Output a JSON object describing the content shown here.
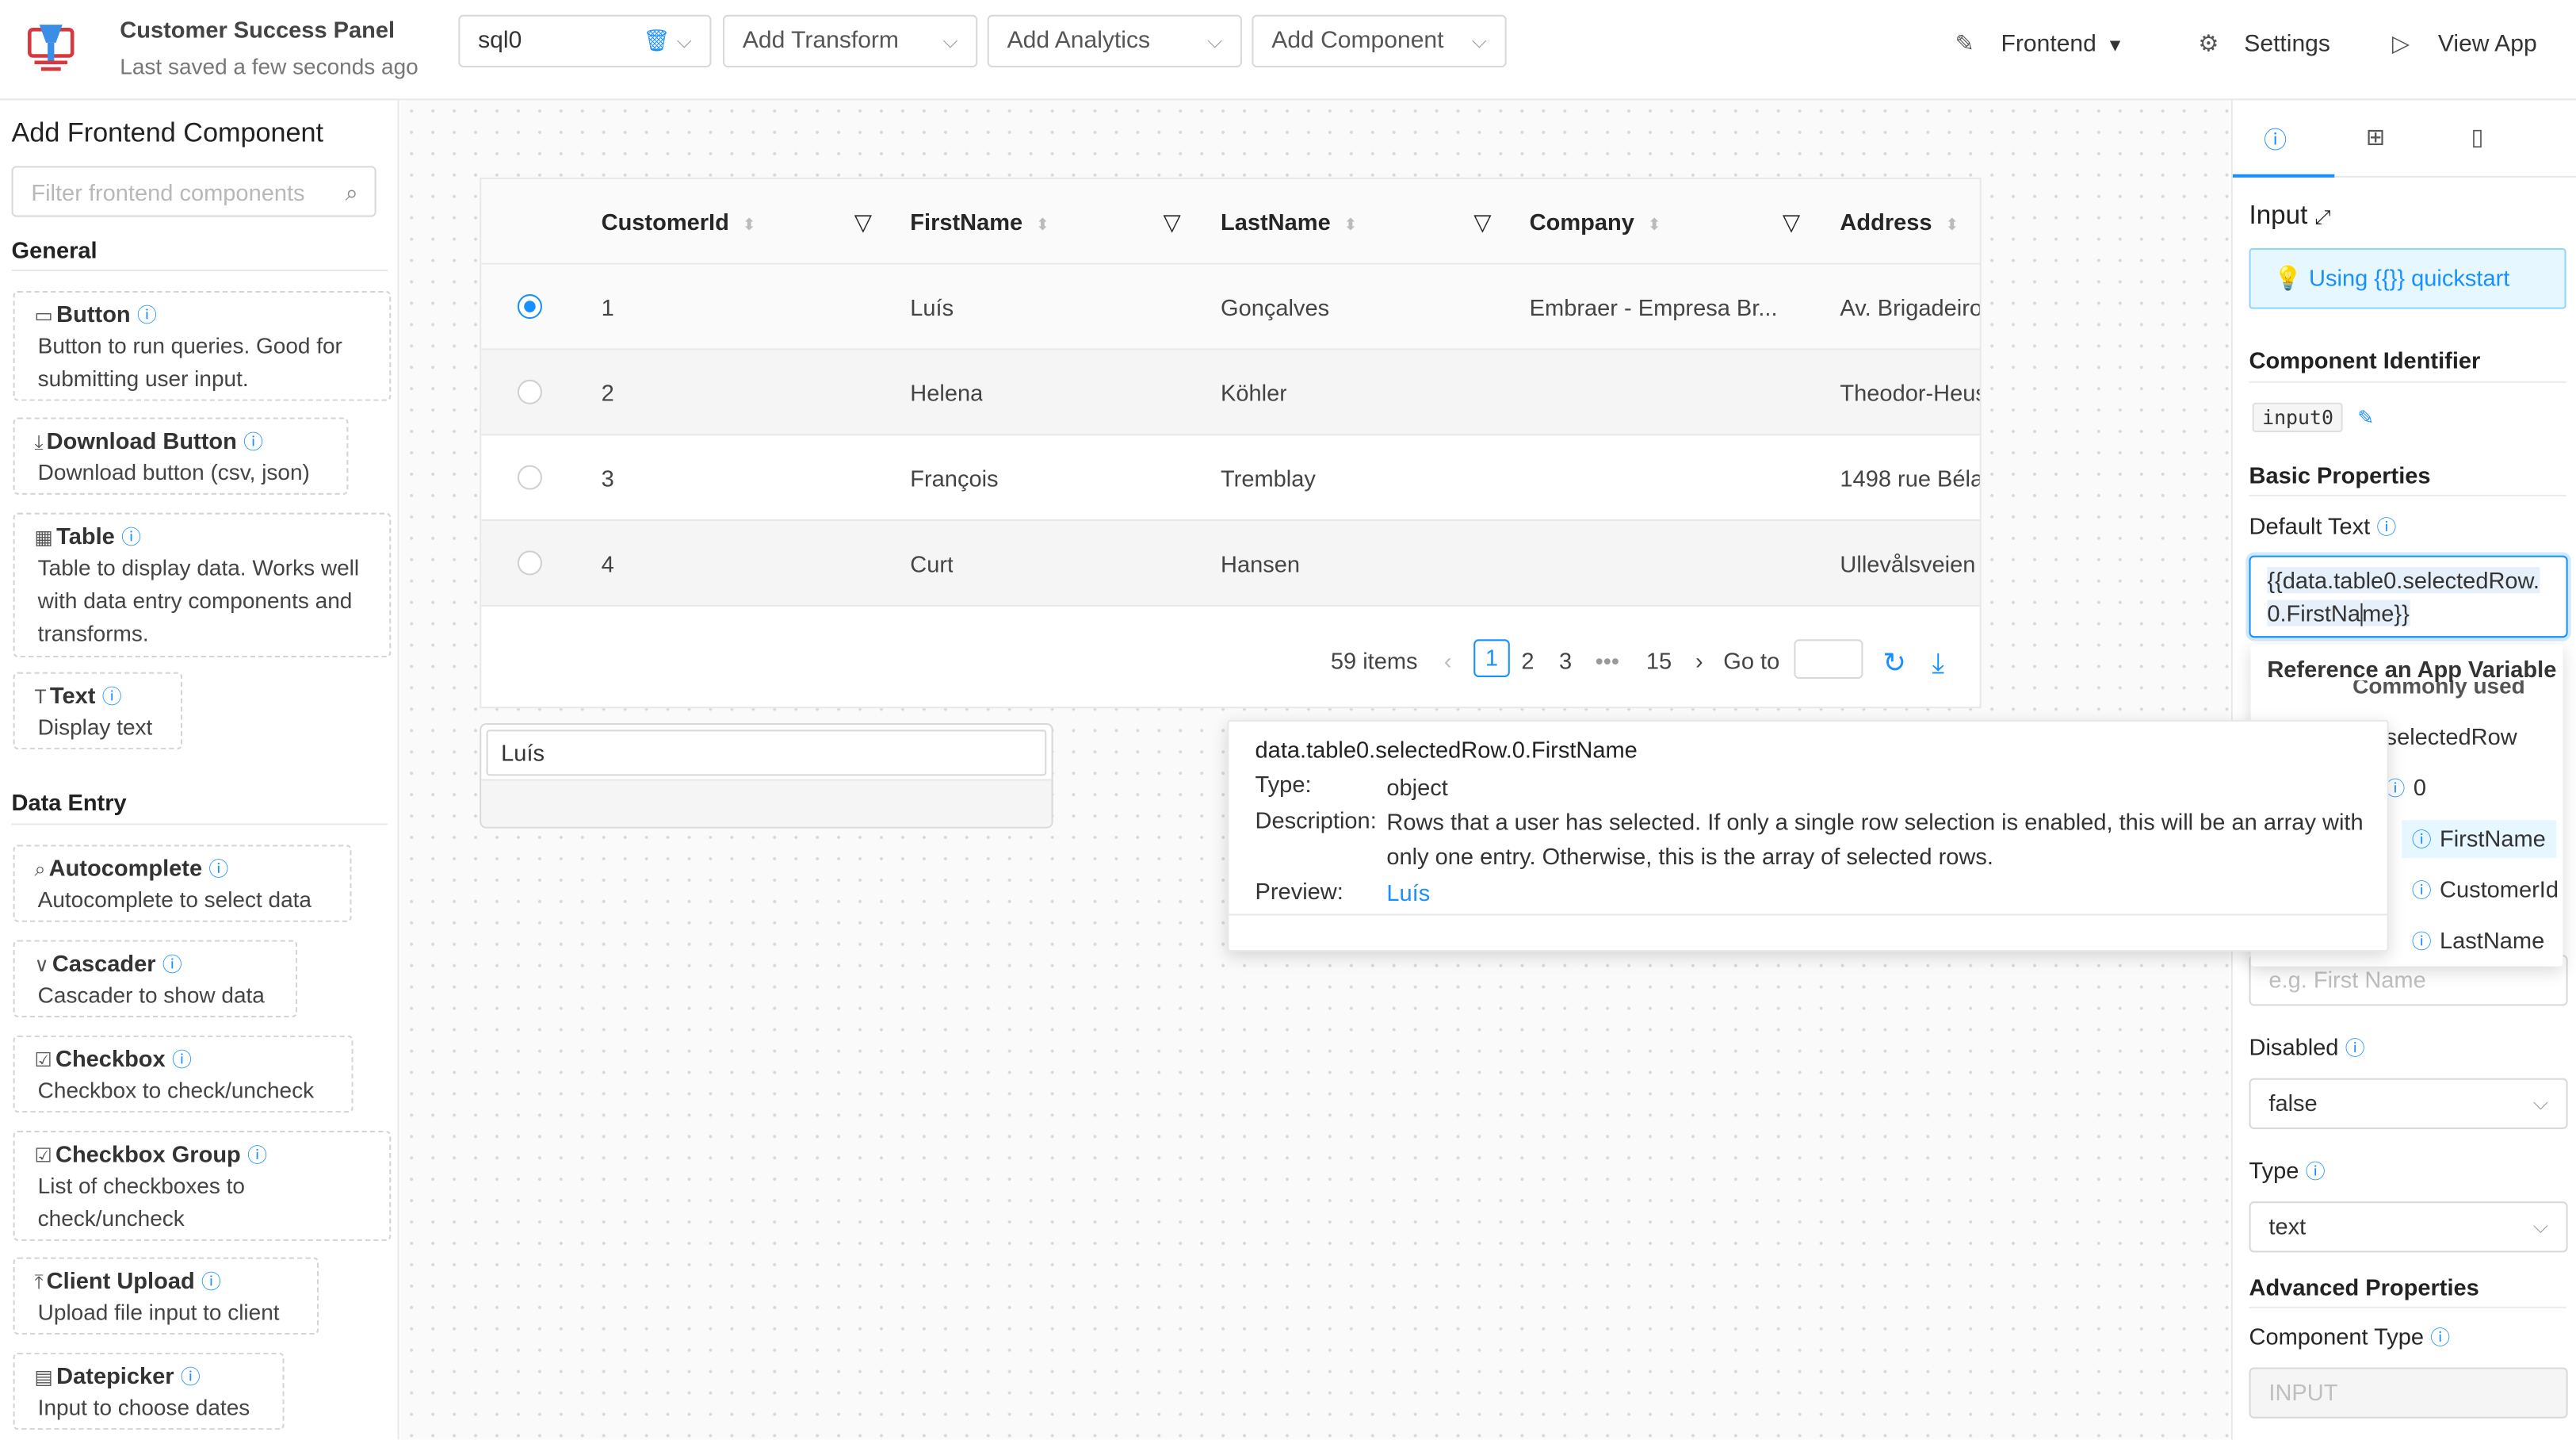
{
  "header": {
    "app_title": "Customer Success Panel",
    "saved_status": "Last saved a few seconds ago",
    "query_select": "sql0",
    "add_transform": "Add Transform",
    "add_analytics": "Add Analytics",
    "add_component": "Add Component",
    "frontend_menu": "Frontend",
    "settings": "Settings",
    "view_app": "View App"
  },
  "left": {
    "title": "Add Frontend Component",
    "filter_placeholder": "Filter frontend components",
    "cat_general": "General",
    "cat_data_entry": "Data Entry",
    "components": [
      {
        "name": "Button",
        "desc": "Button to run queries. Good for submitting user input."
      },
      {
        "name": "Download Button",
        "desc": "Download button (csv, json)"
      },
      {
        "name": "Table",
        "desc": "Table to display data. Works well with data entry components and transforms."
      },
      {
        "name": "Text",
        "desc": "Display text"
      },
      {
        "name": "Autocomplete",
        "desc": "Autocomplete to select data"
      },
      {
        "name": "Cascader",
        "desc": "Cascader to show data"
      },
      {
        "name": "Checkbox",
        "desc": "Checkbox to check/uncheck"
      },
      {
        "name": "Checkbox Group",
        "desc": "List of checkboxes to check/uncheck"
      },
      {
        "name": "Client Upload",
        "desc": "Upload file input to client"
      },
      {
        "name": "Datepicker",
        "desc": "Input to choose dates"
      }
    ]
  },
  "table": {
    "columns": [
      "CustomerId",
      "FirstName",
      "LastName",
      "Company",
      "Address"
    ],
    "rows": [
      {
        "id": "1",
        "first": "Luís",
        "last": "Gonçalves",
        "company": "Embraer - Empresa Br...",
        "address": "Av. Brigadeiro"
      },
      {
        "id": "2",
        "first": "Helena",
        "last": "Köhler",
        "company": "",
        "address": "Theodor-Heus"
      },
      {
        "id": "3",
        "first": "François",
        "last": "Tremblay",
        "company": "",
        "address": "1498 rue Béla"
      },
      {
        "id": "4",
        "first": "Curt",
        "last": "Hansen",
        "company": "",
        "address": "Ullevålsveien"
      }
    ],
    "selected_row": 0,
    "pager": {
      "total": "59 items",
      "pages": [
        "1",
        "2",
        "3",
        "•••",
        "15"
      ],
      "current": "1",
      "goto": "Go to"
    }
  },
  "input_component": {
    "value": "Luís"
  },
  "tooltip": {
    "path": "data.table0.selectedRow.0.FirstName",
    "type_label": "Type:",
    "type_value": "object",
    "desc_label": "Description:",
    "desc_value": "Rows that a user has selected. If only a single row selection is enabled, this will be an array with only one entry. Otherwise, this is the array of selected rows.",
    "preview_label": "Preview:",
    "preview_value": "Luís"
  },
  "right": {
    "component_title": "Input",
    "quickstart": "Using {{}} quickstart",
    "identifier_label": "Component Identifier",
    "identifier_value": "input0",
    "basic_props": "Basic Properties",
    "default_text_label": "Default Text",
    "default_text_before": "{{data.table0.selectedRow.",
    "default_text_mid": "0.FirstNa",
    "default_text_after": "me}}",
    "placeholder_value": "e.g. First Name",
    "disabled_label": "Disabled",
    "disabled_value": "false",
    "type_label": "Type",
    "type_value": "text",
    "advanced_props": "Advanced Properties",
    "component_type_label": "Component Type",
    "component_type_value": "INPUT"
  },
  "dropdown": {
    "title": "Reference an App Variable",
    "commonly_used": "Commonly used",
    "items": [
      "selectedRow",
      "0",
      "FirstName",
      "CustomerId",
      "LastName"
    ],
    "highlighted": "FirstName"
  },
  "colors": {
    "accent": "#1890ff",
    "logo_red": "#d9363e"
  }
}
